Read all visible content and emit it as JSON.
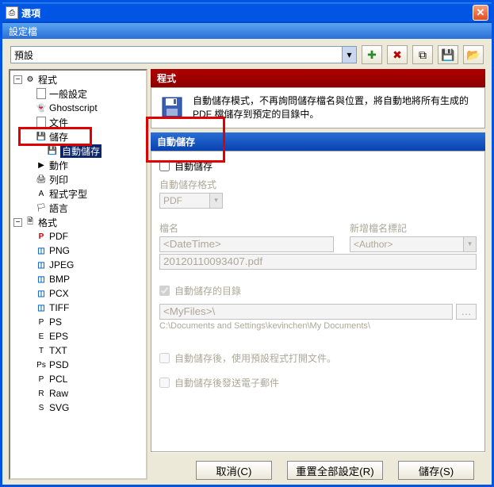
{
  "window": {
    "title": "選項"
  },
  "subheader": "設定檔",
  "profile": {
    "value": "預設"
  },
  "toolbar_icons": [
    "add-profile",
    "remove-profile",
    "copy-profile",
    "save-profile",
    "open-folder"
  ],
  "tree": {
    "root1": "程式",
    "items1": [
      "一般設定",
      "Ghostscript",
      "文件",
      "儲存",
      "自動儲存",
      "動作",
      "列印",
      "程式字型",
      "語言"
    ],
    "selected_index": 4,
    "root2": "格式",
    "items2": [
      "PDF",
      "PNG",
      "JPEG",
      "BMP",
      "PCX",
      "TIFF",
      "PS",
      "EPS",
      "TXT",
      "PSD",
      "PCL",
      "Raw",
      "SVG"
    ]
  },
  "content": {
    "header": "程式",
    "description": "自動儲存模式，不再詢問儲存檔名與位置，將自動地將所有生成的 PDF 檔儲存到預定的目錄中。",
    "section": "自動儲存",
    "checkbox_autosave": "自動儲存",
    "lbl_format": "自動儲存格式",
    "format_value": "PDF",
    "lbl_filename": "檔名",
    "filename_value": "<DateTime>",
    "lbl_tag": "新增檔名標記",
    "tag_value": "<Author>",
    "example_filename": "20120110093407.pdf",
    "chk_autofolder": "自動儲存的目錄",
    "folder_value": "<MyFiles>\\",
    "folder_resolved": "C:\\Documents and Settings\\kevinchen\\My Documents\\",
    "chk_openafter": "自動儲存後，使用預設程式打開文件。",
    "chk_emailafter": "自動儲存後發送電子郵件"
  },
  "buttons": {
    "cancel": "取消(C)",
    "reset": "重置全部設定(R)",
    "save": "儲存(S)"
  }
}
